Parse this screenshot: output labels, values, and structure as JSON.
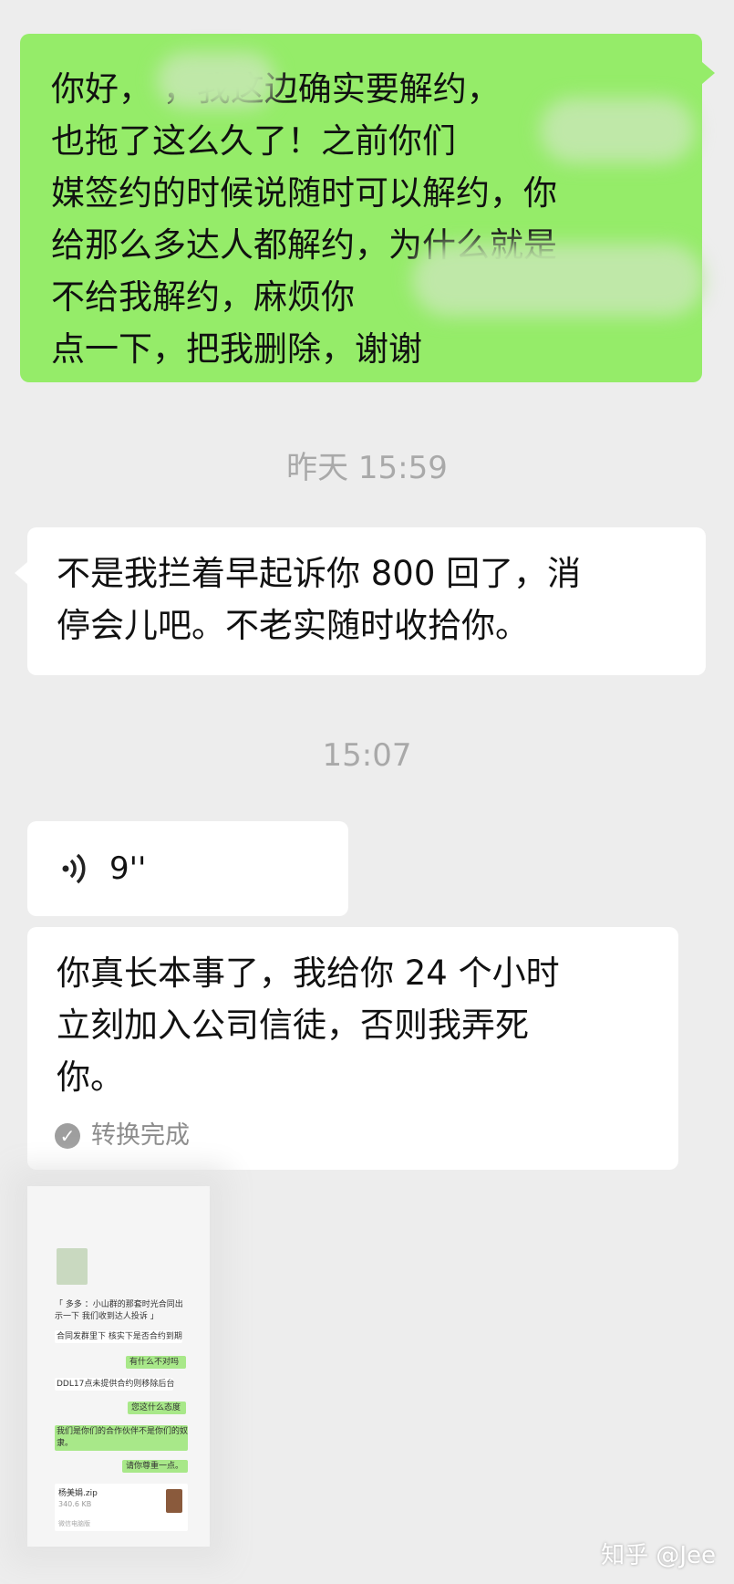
{
  "messages": {
    "m1": {
      "lines": [
        "你好，      ，我这边确实要解约，",
        "也拖了这么久了！之前你们",
        "媒签约的时候说随时可以解约，你",
        "给那么多达人都解约，为什么就是",
        "不给我解约，麻烦你",
        "点一下，把我删除，谢谢"
      ]
    },
    "t1": "昨天 15:59",
    "m2": {
      "lines": [
        "不是我拦着早起诉你 800 回了，消",
        "停会儿吧。不老实随时收拾你。"
      ]
    },
    "t2": "15:07",
    "voice": {
      "duration": "9''"
    },
    "m3": {
      "lines": [
        "你真长本事了，我给你 24 个小时",
        "立刻加入公司信徒，否则我弄死",
        "你。"
      ],
      "status": "转换完成"
    },
    "thumbnail": {
      "lines": {
        "a": "「 多多 ：小山群的那套时光合同出",
        "b": "示一下 我们收到达人投诉 」",
        "c": "合同发群里下  核实下是否合约到期",
        "d": "有什么不对吗",
        "e": "DDL17点未提供合约则移除后台",
        "f": "您这什么态度",
        "g": "我们是你们的合作伙伴不是你们的奴",
        "h": "隶。",
        "i": "请你尊重一点。",
        "file_name": "杨美娟.zip",
        "file_size": "340.6 KB",
        "footer": "微信电脑版"
      }
    },
    "watermark": "知乎 @Jee"
  },
  "colors": {
    "background": "#ededed",
    "sent_bubble": "#95ec69",
    "received_bubble": "#ffffff",
    "timestamp": "#a9a9a9"
  }
}
